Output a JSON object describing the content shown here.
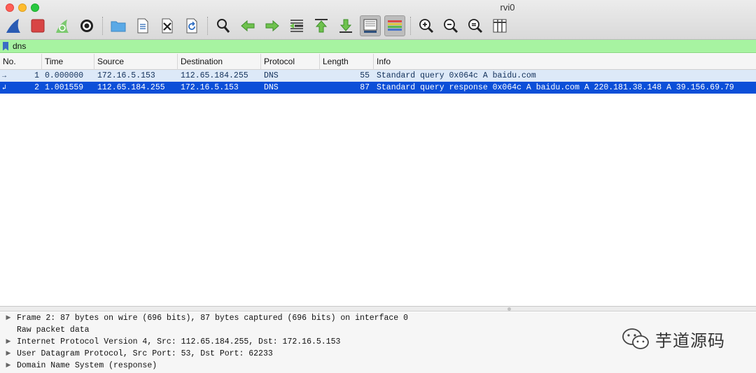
{
  "window": {
    "title": "rvi0"
  },
  "toolbar": {
    "buttons": [
      {
        "name": "start-capture",
        "icon": "shark-fin-icon"
      },
      {
        "name": "stop-capture",
        "icon": "stop-square-icon"
      },
      {
        "name": "restart-capture",
        "icon": "restart-fin-icon"
      },
      {
        "name": "capture-options",
        "icon": "gear-icon"
      },
      {
        "name": "open-file",
        "icon": "folder-icon"
      },
      {
        "name": "save-file",
        "icon": "document-icon"
      },
      {
        "name": "close-file",
        "icon": "close-file-icon"
      },
      {
        "name": "reload-file",
        "icon": "reload-icon"
      },
      {
        "name": "find-packet",
        "icon": "magnifier-icon"
      },
      {
        "name": "go-back",
        "icon": "arrow-left-icon"
      },
      {
        "name": "go-forward",
        "icon": "arrow-right-icon"
      },
      {
        "name": "go-to-packet",
        "icon": "go-to-packet-icon"
      },
      {
        "name": "first-packet",
        "icon": "arrow-up-first-icon"
      },
      {
        "name": "last-packet",
        "icon": "arrow-down-last-icon"
      },
      {
        "name": "autoscroll",
        "icon": "autoscroll-icon"
      },
      {
        "name": "colorize",
        "icon": "colorize-lines-icon"
      },
      {
        "name": "zoom-in",
        "icon": "zoom-in-icon"
      },
      {
        "name": "zoom-out",
        "icon": "zoom-out-icon"
      },
      {
        "name": "normal-size",
        "icon": "zoom-reset-icon"
      },
      {
        "name": "resize-columns",
        "icon": "resize-columns-icon"
      }
    ]
  },
  "filter": {
    "value": "dns"
  },
  "packet_list": {
    "columns": [
      "No.",
      "Time",
      "Source",
      "Destination",
      "Protocol",
      "Length",
      "Info"
    ],
    "rows": [
      {
        "no": "1",
        "time": "0.000000",
        "source": "172.16.5.153",
        "destination": "112.65.184.255",
        "protocol": "DNS",
        "length": "55",
        "info": "Standard query 0x064c A baidu.com"
      },
      {
        "no": "2",
        "time": "1.001559",
        "source": "112.65.184.255",
        "destination": "172.16.5.153",
        "protocol": "DNS",
        "length": "87",
        "info": "Standard query response 0x064c A baidu.com A 220.181.38.148 A 39.156.69.79"
      }
    ]
  },
  "details": [
    {
      "text": "Frame 2: 87 bytes on wire (696 bits), 87 bytes captured (696 bits) on interface 0",
      "expandable": true
    },
    {
      "text": "Raw packet data",
      "expandable": false
    },
    {
      "text": "Internet Protocol Version 4, Src: 112.65.184.255, Dst: 172.16.5.153",
      "expandable": true
    },
    {
      "text": "User Datagram Protocol, Src Port: 53, Dst Port: 62233",
      "expandable": true
    },
    {
      "text": "Domain Name System (response)",
      "expandable": true
    }
  ],
  "watermark": {
    "text": "芋道源码",
    "icon": "wechat-icon"
  },
  "colors": {
    "filter_bg": "#a7f3a1",
    "selected_row": "#0c4fd8",
    "related_row": "#dde9f8"
  }
}
